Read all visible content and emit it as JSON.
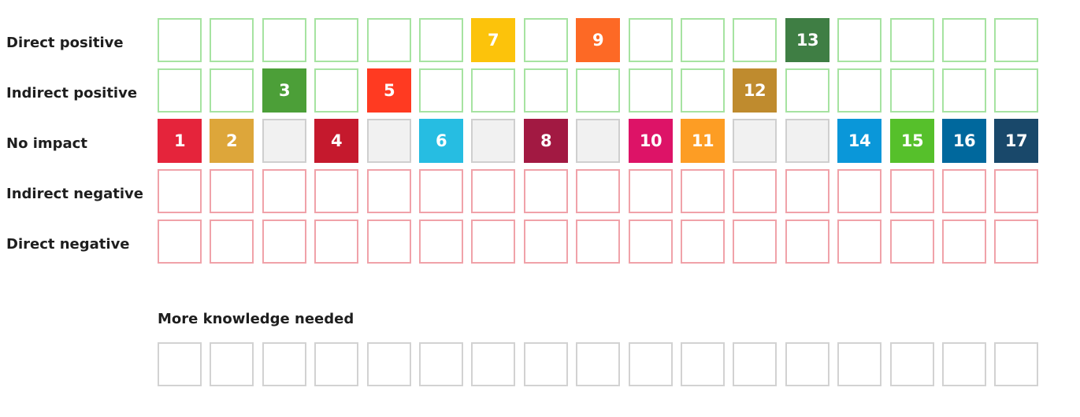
{
  "rows": [
    {
      "id": "direct-positive",
      "label": "Direct positive",
      "style": "empty-positive",
      "filled": {
        "7": "#fcc30b",
        "9": "#fd6925",
        "13": "#3f7e44"
      }
    },
    {
      "id": "indirect-positive",
      "label": "Indirect positive",
      "style": "empty-positive",
      "filled": {
        "3": "#4c9f38",
        "5": "#ff3a21",
        "12": "#bf8b2e"
      }
    },
    {
      "id": "no-impact",
      "label": "No impact",
      "style": "empty-neutral",
      "filled": {
        "1": "#e5243b",
        "2": "#dda63a",
        "4": "#c5192d",
        "6": "#26bde2",
        "8": "#a21942",
        "10": "#dd1367",
        "11": "#fd9d24",
        "14": "#0a97d9",
        "15": "#56c02b",
        "16": "#00689d",
        "17": "#19486a"
      }
    },
    {
      "id": "indirect-negative",
      "label": "Indirect negative",
      "style": "empty-negative",
      "filled": {}
    },
    {
      "id": "direct-negative",
      "label": "Direct negative",
      "style": "empty-negative",
      "filled": {}
    }
  ],
  "knowledge": {
    "label": "More knowledge needed",
    "style": "empty-knowledge",
    "filled": {}
  },
  "goal_count": 17
}
